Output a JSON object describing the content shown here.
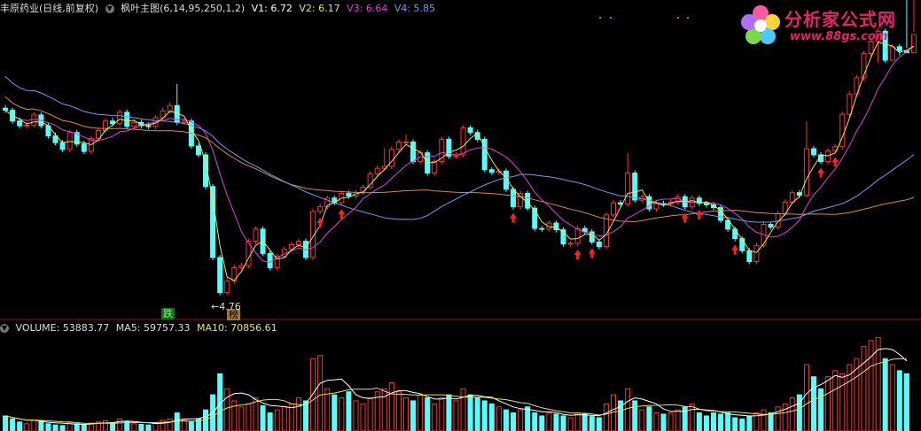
{
  "header": {
    "stock_name": "丰原药业(日线,前复权)",
    "indicator_name": "枫叶主图(6,14,95,250,1,2)",
    "v1_label": "V1: 6.72",
    "v2_label": "V2: 6.17",
    "v3_label": "V3: 6.64",
    "v4_label": "V4: 5.85",
    "v1_color": "#ffffff",
    "v2_color": "#e8e84a",
    "v3_color": "#e040e0",
    "v4_color": "#4a9eff"
  },
  "volume_header": {
    "volume_label": "VOLUME: 53883.77",
    "ma5_label": "MA5: 59757.33",
    "ma10_label": "MA10: 70856.61",
    "ma5_color": "#ffffff",
    "ma10_color": "#e8e84a"
  },
  "annotations": {
    "low_price": "4.76",
    "tag_fall": "跌",
    "tag_list": "榜"
  },
  "logo": {
    "name": "分析家公式网",
    "url": "www.88gs.com"
  },
  "colors": {
    "up": "#ff3232",
    "down": "#54ffff",
    "ma_white": "#ffffff",
    "ma_yellow": "#e8e84a",
    "ma_magenta": "#e040e0",
    "ma_blue": "#6a9ef0",
    "ma_orange": "#e08a3a",
    "signal_arrow": "#ff2020",
    "separator": "#9a1010"
  },
  "chart_data": {
    "type": "candlestick",
    "series": [
      {
        "name": "price",
        "o": [
          7.41,
          7.38,
          7.22,
          7.15,
          7.16,
          7.31,
          7.15,
          7.0,
          6.9,
          6.8,
          7.05,
          6.88,
          6.77,
          6.96,
          7.08,
          7.22,
          7.18,
          7.35,
          7.14,
          7.2,
          7.15,
          7.14,
          7.27,
          7.37,
          7.45,
          7.2,
          7.22,
          6.85,
          6.72,
          6.25,
          5.2,
          4.68,
          4.85,
          5.05,
          5.08,
          5.44,
          5.62,
          5.26,
          5.05,
          5.22,
          5.32,
          5.39,
          5.44,
          5.2,
          5.88,
          5.95,
          6.08,
          6.01,
          6.15,
          6.11,
          6.16,
          6.24,
          6.44,
          6.52,
          6.55,
          6.8,
          6.91,
          6.91,
          6.62,
          6.75,
          6.45,
          6.62,
          6.95,
          6.7,
          6.72,
          7.12,
          7.05,
          6.95,
          6.5,
          6.46,
          6.48,
          6.21,
          5.95,
          6.15,
          5.93,
          5.63,
          5.62,
          5.71,
          5.61,
          5.4,
          5.41,
          5.63,
          5.58,
          5.43,
          5.36,
          5.83,
          6.01,
          5.99,
          6.45,
          6.05,
          6.1,
          5.92,
          6.0,
          5.99,
          6.02,
          6.1,
          5.95,
          6.08,
          6.0,
          5.98,
          5.94,
          5.75,
          5.62,
          5.48,
          5.3,
          5.14,
          5.38,
          5.69,
          5.65,
          5.85,
          6.02,
          6.16,
          6.12,
          6.81,
          6.72,
          6.62,
          6.78,
          6.84,
          7.32,
          7.62,
          7.86,
          8.22,
          8.4,
          8.55,
          8.12,
          8.32,
          8.26,
          8.23
        ],
        "c": [
          7.38,
          7.22,
          7.15,
          7.16,
          7.31,
          7.15,
          7.0,
          6.9,
          6.8,
          7.05,
          6.88,
          6.77,
          6.96,
          7.08,
          7.22,
          7.18,
          7.35,
          7.14,
          7.2,
          7.15,
          7.14,
          7.27,
          7.37,
          7.45,
          7.2,
          7.22,
          6.85,
          6.72,
          6.25,
          5.2,
          4.68,
          4.85,
          5.05,
          5.08,
          5.44,
          5.62,
          5.26,
          5.05,
          5.22,
          5.32,
          5.39,
          5.44,
          5.2,
          5.88,
          5.95,
          6.08,
          6.01,
          6.15,
          6.11,
          6.16,
          6.24,
          6.44,
          6.52,
          6.55,
          6.8,
          6.91,
          6.91,
          6.62,
          6.75,
          6.45,
          6.62,
          6.95,
          6.7,
          6.72,
          7.12,
          7.05,
          6.95,
          6.5,
          6.46,
          6.48,
          6.21,
          5.95,
          6.15,
          5.93,
          5.63,
          5.62,
          5.71,
          5.61,
          5.4,
          5.41,
          5.63,
          5.58,
          5.43,
          5.36,
          5.83,
          6.01,
          5.99,
          6.45,
          6.05,
          6.1,
          5.92,
          6.0,
          5.99,
          6.02,
          6.1,
          5.95,
          6.08,
          6.0,
          5.98,
          5.94,
          5.75,
          5.62,
          5.48,
          5.3,
          5.14,
          5.38,
          5.69,
          5.65,
          5.85,
          6.02,
          6.16,
          6.12,
          6.81,
          6.72,
          6.62,
          6.78,
          6.84,
          7.32,
          7.62,
          7.86,
          8.22,
          8.4,
          8.55,
          8.12,
          8.32,
          8.26,
          8.23,
          8.5
        ],
        "h": [
          7.46,
          7.42,
          7.27,
          7.21,
          7.35,
          7.35,
          7.19,
          7.05,
          6.94,
          7.09,
          7.09,
          6.93,
          7.0,
          7.13,
          7.26,
          7.27,
          7.39,
          7.39,
          7.25,
          7.24,
          7.2,
          7.31,
          7.42,
          7.5,
          7.77,
          7.26,
          7.26,
          6.89,
          6.76,
          6.29,
          5.24,
          4.89,
          5.09,
          5.12,
          5.48,
          5.66,
          5.66,
          5.3,
          5.26,
          5.36,
          5.43,
          5.48,
          5.48,
          5.92,
          6.0,
          6.12,
          6.12,
          6.19,
          6.19,
          6.2,
          6.28,
          6.48,
          6.56,
          6.82,
          6.84,
          6.95,
          7.02,
          6.95,
          6.79,
          6.79,
          6.66,
          6.99,
          6.99,
          6.76,
          7.16,
          7.16,
          7.09,
          6.99,
          6.54,
          6.52,
          6.52,
          6.25,
          6.19,
          6.19,
          5.97,
          5.67,
          5.75,
          5.75,
          5.65,
          5.45,
          5.67,
          5.67,
          5.62,
          5.47,
          5.87,
          6.05,
          6.05,
          6.75,
          6.49,
          6.14,
          6.14,
          6.04,
          6.04,
          6.06,
          6.14,
          6.14,
          6.12,
          6.12,
          6.04,
          6.02,
          5.98,
          5.79,
          5.66,
          5.52,
          5.34,
          5.42,
          5.73,
          5.73,
          5.89,
          6.06,
          6.2,
          6.2,
          7.22,
          6.85,
          6.76,
          6.82,
          6.88,
          7.36,
          7.66,
          7.9,
          8.26,
          8.44,
          8.59,
          8.59,
          8.36,
          8.36,
          8.3,
          8.54
        ],
        "l": [
          7.34,
          7.18,
          7.11,
          7.11,
          7.12,
          7.11,
          6.96,
          6.86,
          6.76,
          6.76,
          6.84,
          6.73,
          6.73,
          6.92,
          7.04,
          7.14,
          7.14,
          7.1,
          7.1,
          7.11,
          7.1,
          7.1,
          7.23,
          7.33,
          7.16,
          7.16,
          6.81,
          6.68,
          6.21,
          5.16,
          4.64,
          4.64,
          4.81,
          5.01,
          5.04,
          5.4,
          5.22,
          5.01,
          5.01,
          5.18,
          5.28,
          5.35,
          5.16,
          5.16,
          5.84,
          5.91,
          5.97,
          5.97,
          6.07,
          6.07,
          6.12,
          6.2,
          6.4,
          6.48,
          6.51,
          6.76,
          6.87,
          6.58,
          6.58,
          6.41,
          6.41,
          6.58,
          6.66,
          6.66,
          6.68,
          7.01,
          6.91,
          6.46,
          6.42,
          6.42,
          6.17,
          5.91,
          5.91,
          5.89,
          5.59,
          5.58,
          5.58,
          5.57,
          5.36,
          5.36,
          5.37,
          5.54,
          5.39,
          5.32,
          5.32,
          5.79,
          5.95,
          5.95,
          6.01,
          6.01,
          5.88,
          5.88,
          5.95,
          5.95,
          5.98,
          5.91,
          5.91,
          5.96,
          5.94,
          5.9,
          5.71,
          5.58,
          5.44,
          5.26,
          5.1,
          5.1,
          5.34,
          5.61,
          5.61,
          5.81,
          5.98,
          6.08,
          6.08,
          6.68,
          6.58,
          6.58,
          6.74,
          6.8,
          7.28,
          7.58,
          7.82,
          8.18,
          8.08,
          8.08,
          8.22,
          8.19
        ]
      },
      {
        "name": "volume",
        "values": [
          25,
          20,
          15,
          12,
          18,
          16,
          12,
          10,
          9,
          14,
          12,
          10,
          13,
          15,
          17,
          14,
          20,
          16,
          12,
          11,
          10,
          13,
          18,
          20,
          30,
          18,
          15,
          20,
          35,
          60,
          95,
          70,
          50,
          40,
          45,
          55,
          42,
          30,
          35,
          40,
          45,
          55,
          50,
          120,
          125,
          70,
          60,
          55,
          65,
          50,
          45,
          55,
          65,
          70,
          80,
          65,
          55,
          50,
          60,
          55,
          45,
          55,
          60,
          50,
          70,
          60,
          55,
          50,
          45,
          40,
          35,
          30,
          35,
          40,
          30,
          25,
          30,
          28,
          25,
          22,
          30,
          28,
          24,
          22,
          45,
          60,
          50,
          70,
          50,
          35,
          40,
          30,
          28,
          30,
          35,
          40,
          45,
          30,
          25,
          30,
          28,
          30,
          22,
          20,
          25,
          30,
          35,
          30,
          40,
          45,
          55,
          60,
          110,
          90,
          70,
          90,
          100,
          95,
          110,
          120,
          140,
          150,
          155,
          120,
          110,
          100,
          95
        ]
      }
    ],
    "ma_periods": [
      6,
      14,
      95,
      250
    ],
    "volume_ma_periods": [
      5,
      10
    ],
    "last_values": {
      "V1": 6.72,
      "V2": 6.17,
      "V3": 6.64,
      "V4": 5.85
    },
    "low_point_value": 4.76,
    "signal_arrows_at": [
      44,
      47,
      71,
      80,
      82,
      95,
      97,
      102,
      114,
      116
    ]
  }
}
